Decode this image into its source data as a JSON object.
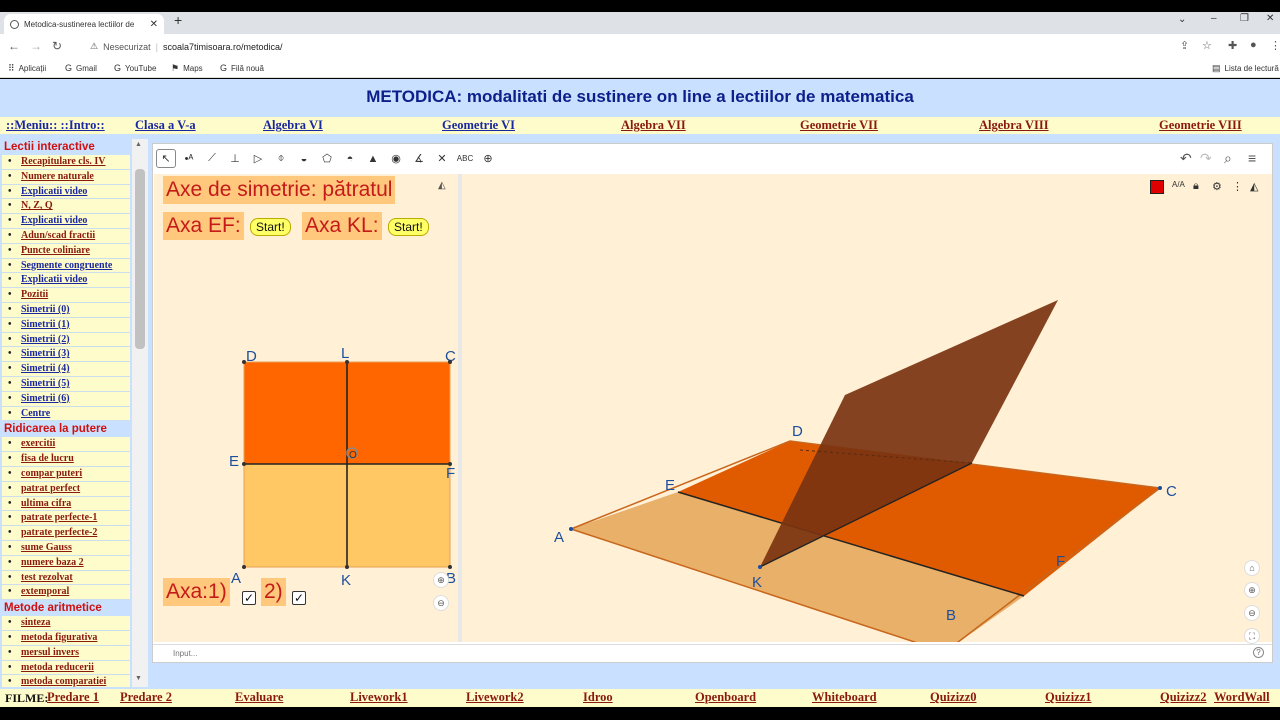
{
  "browser": {
    "tab_title": "Metodica-sustinerea lectiilor de",
    "tab_close": "✕",
    "new_tab": "+",
    "security_label": "Nesecurizat",
    "url": "scoala7timisoara.ro/metodica/",
    "bookmarks": [
      "Aplicații",
      "Gmail",
      "YouTube",
      "Maps",
      "Filă nouă"
    ],
    "reading_list": "Lista de lectură"
  },
  "page": {
    "title": "METODICA: modalitati de sustinere on line a lectiilor de matematica",
    "menu_intro": "::Meniu:: ::Intro::",
    "menu_links": [
      "Clasa a V-a",
      "Algebra VI",
      "Geometrie VI",
      "Algebra VII",
      "Geometrie VII",
      "Algebra VIII",
      "Geometrie VIII"
    ]
  },
  "sidebar": {
    "sections": [
      {
        "title": "Lectii interactive",
        "items": [
          {
            "label": "Recapitulare cls. IV",
            "color": "red"
          },
          {
            "label": "Numere naturale",
            "color": "red"
          },
          {
            "label": "Explicatii video",
            "color": "blue"
          },
          {
            "label": "N, Z, Q",
            "color": "red"
          },
          {
            "label": "Explicatii video",
            "color": "blue"
          },
          {
            "label": "Adun/scad fractii",
            "color": "red"
          },
          {
            "label": "Puncte coliniare",
            "color": "red"
          },
          {
            "label": "Segmente congruente",
            "color": "blue"
          },
          {
            "label": "Explicatii video",
            "color": "blue"
          },
          {
            "label": "Pozitii",
            "color": "red"
          },
          {
            "label": "Simetrii (0)",
            "color": "blue"
          },
          {
            "label": "Simetrii (1)",
            "color": "blue"
          },
          {
            "label": "Simetrii (2)",
            "color": "blue"
          },
          {
            "label": "Simetrii (3)",
            "color": "blue"
          },
          {
            "label": "Simetrii (4)",
            "color": "blue"
          },
          {
            "label": "Simetrii (5)",
            "color": "blue"
          },
          {
            "label": "Simetrii (6)",
            "color": "blue"
          },
          {
            "label": "Centre",
            "color": "blue"
          }
        ]
      },
      {
        "title": "Ridicarea la putere",
        "items": [
          {
            "label": "exercitii",
            "color": "red"
          },
          {
            "label": "fisa de lucru",
            "color": "red"
          },
          {
            "label": "compar puteri",
            "color": "red"
          },
          {
            "label": "patrat perfect",
            "color": "red"
          },
          {
            "label": "ultima cifra",
            "color": "red"
          },
          {
            "label": "patrate perfecte-1",
            "color": "red"
          },
          {
            "label": "patrate perfecte-2",
            "color": "red"
          },
          {
            "label": "sume Gauss",
            "color": "red"
          },
          {
            "label": "numere baza 2",
            "color": "red"
          },
          {
            "label": "test rezolvat",
            "color": "red"
          },
          {
            "label": "extemporal",
            "color": "red"
          }
        ]
      },
      {
        "title": "Metode aritmetice",
        "items": [
          {
            "label": "sinteza",
            "color": "red"
          },
          {
            "label": "metoda figurativa",
            "color": "red"
          },
          {
            "label": "mersul invers",
            "color": "red"
          },
          {
            "label": "metoda reducerii",
            "color": "red"
          },
          {
            "label": "metoda comparatiei",
            "color": "red"
          }
        ]
      }
    ]
  },
  "applet": {
    "title_text": "Axe de simetrie: pătratul",
    "axis_ef_label": "Axa EF:",
    "axis_kl_label": "Axa KL:",
    "start_label": "Start!",
    "axa_label": "Axa:1)",
    "axa2_label": "2)",
    "check_mark": "✓",
    "checkbox1_checked": true,
    "checkbox2_checked": true,
    "input_placeholder": "Input...",
    "help_label": "?",
    "tool_text": "ABC",
    "square_points": [
      "D",
      "L",
      "C",
      "E",
      "O",
      "F",
      "A",
      "K",
      "B"
    ],
    "points3d": [
      "D",
      "E",
      "C",
      "A",
      "F",
      "K",
      "B"
    ],
    "colors": {
      "top_half": "#ff6600",
      "bottom_half": "#ffc864",
      "plane": "#7a3310",
      "view_bg": "#fff0d6",
      "label_box": "#ffc87c",
      "label_text": "#c41a1a",
      "point_label": "#1c4e9e"
    }
  },
  "bottom": {
    "filme_label": "FILME:",
    "links": [
      "Predare 1",
      "Predare 2",
      "Evaluare",
      "Livework1",
      "Livework2",
      "Idroo",
      "Openboard",
      "Whiteboard",
      "Quizizz0",
      "Quizizz1",
      "Quizizz2",
      "WordWall"
    ]
  }
}
